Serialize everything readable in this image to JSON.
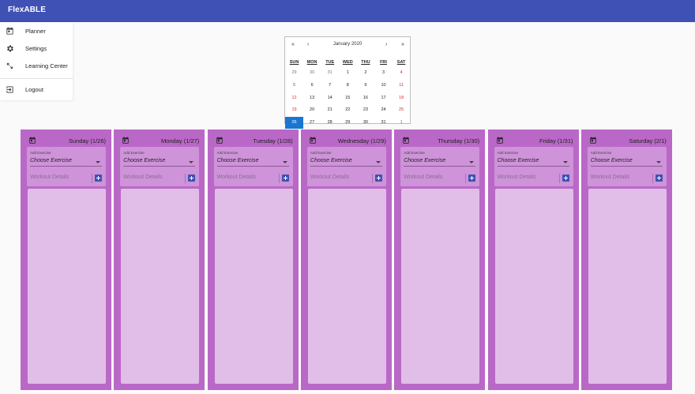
{
  "app": {
    "title": "FlexABLE"
  },
  "nav": {
    "items": [
      {
        "label": "Planner",
        "icon": "calendar-icon"
      },
      {
        "label": "Settings",
        "icon": "gear-icon"
      },
      {
        "label": "Learning Center",
        "icon": "expand-arrows-icon"
      },
      {
        "label": "Logout",
        "icon": "logout-icon"
      }
    ]
  },
  "calendar": {
    "month_label": "January 2020",
    "nav": {
      "prev_year": "«",
      "prev_month": "‹",
      "next_month": "›",
      "next_year": "»"
    },
    "weekdays": [
      "SUN",
      "MON",
      "TUE",
      "WED",
      "THU",
      "FRI",
      "SAT"
    ],
    "weeks": [
      [
        "29",
        "30",
        "31",
        "1",
        "2",
        "3",
        "4"
      ],
      [
        "5",
        "6",
        "7",
        "8",
        "9",
        "10",
        "11"
      ],
      [
        "12",
        "13",
        "14",
        "15",
        "16",
        "17",
        "18"
      ],
      [
        "19",
        "20",
        "21",
        "22",
        "23",
        "24",
        "25"
      ],
      [
        "26",
        "27",
        "28",
        "29",
        "30",
        "31",
        "1"
      ]
    ],
    "selected": "26",
    "colors": {
      "selected": "#1976d2",
      "weekend": "#d32f2f"
    }
  },
  "exercise_form": {
    "add_label": "Add Exercise",
    "select_value": "Choose Exercise",
    "details_placeholder": "Workout Details"
  },
  "days": [
    {
      "title": "Sunday (1/26)"
    },
    {
      "title": "Monday (1/27)"
    },
    {
      "title": "Tuesday (1/28)"
    },
    {
      "title": "Wednesday (1/29)"
    },
    {
      "title": "Thursday (1/30)"
    },
    {
      "title": "Friday (1/31)"
    },
    {
      "title": "Saturday (2/1)"
    }
  ],
  "colors": {
    "appbar": "#3f51b5",
    "day_column": "#ba68c8",
    "exercise_card": "#ce93d8",
    "workout_area": "#e1bee7",
    "add_button": "#3f51b5"
  }
}
